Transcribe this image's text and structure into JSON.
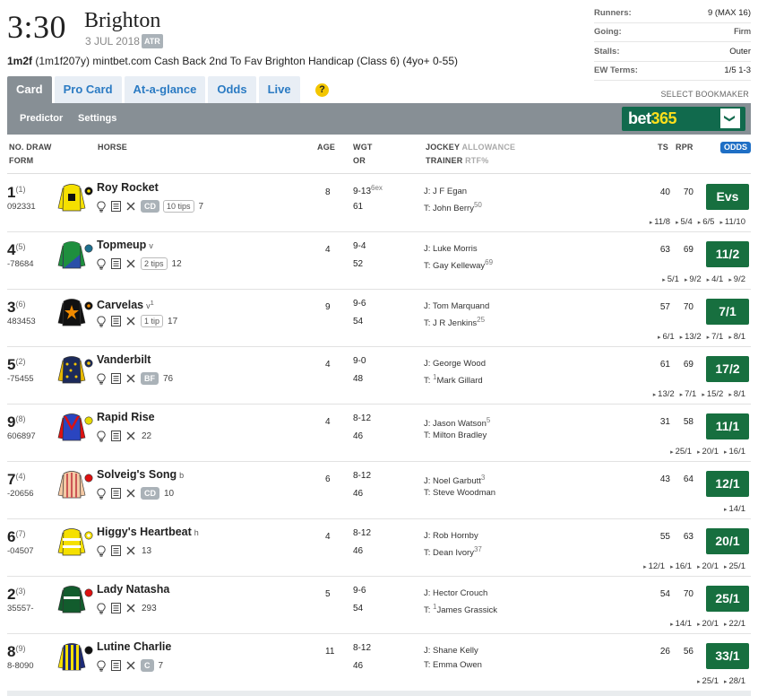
{
  "race": {
    "time": "3:30",
    "course": "Brighton",
    "date": "3 JUL 2018",
    "atr": "ATR",
    "distance": "1m2f",
    "detail": "(1m1f207y) mintbet.com Cash Back 2nd To Fav Brighton Handicap (Class 6) (4yo+ 0-55)"
  },
  "info": [
    {
      "label": "Runners:",
      "value": "9 (MAX 16)"
    },
    {
      "label": "Going:",
      "value": "Firm"
    },
    {
      "label": "Stalls:",
      "value": "Outer"
    },
    {
      "label": "EW Terms:",
      "value": "1/5 1-3"
    }
  ],
  "tabs": [
    "Card",
    "Pro Card",
    "At-a-glance",
    "Odds",
    "Live"
  ],
  "help": "?",
  "select_bookmaker": "SELECT BOOKMAKER",
  "subnav": [
    "Predictor",
    "Settings"
  ],
  "bookmaker": {
    "part1": "bet",
    "part2": "365",
    "chevron": "❯"
  },
  "headers": {
    "no_draw": "NO. DRAW",
    "form": "FORM",
    "horse": "HORSE",
    "age": "AGE",
    "wgt": "WGT",
    "or": "OR",
    "jockey": "JOCKEY",
    "allowance": "ALLOWANCE",
    "trainer": "TRAINER",
    "rtf": "RTF%",
    "ts": "TS",
    "rpr": "RPR",
    "odds": "ODDS"
  },
  "colors": {
    "tab_active": "#878f95",
    "tab_link": "#2b7bc3",
    "odds_green": "#176f3f",
    "bet365_green": "#116a4d",
    "bet365_yellow": "#ffdf1b"
  },
  "runners": [
    {
      "no": "1",
      "draw": "(1)",
      "form": "092331",
      "name": "Roy Rocket",
      "headgear": "",
      "headgear_sup": "",
      "pill": "CD",
      "tips": "10 tips",
      "count": "7",
      "age": "8",
      "wgt": "9-13",
      "wgt_sup": "6ex",
      "or": "61",
      "jockey": "J: J F Egan",
      "jockey_sup": "",
      "trainer_pre": "T: John Berry",
      "trainer_sup": "50",
      "trainer_post": "",
      "ts": "40",
      "rpr": "70",
      "odds": "Evs",
      "movement": [
        "11/8",
        "5/4",
        "6/5",
        "11/10"
      ],
      "silk": "yellow-square"
    },
    {
      "no": "4",
      "draw": "(5)",
      "form": "-78684",
      "name": "Topmeup",
      "headgear": "v",
      "headgear_sup": "",
      "pill": "",
      "tips": "2 tips",
      "count": "12",
      "age": "4",
      "wgt": "9-4",
      "wgt_sup": "",
      "or": "52",
      "jockey": "J: Luke Morris",
      "jockey_sup": "",
      "trainer_pre": "T: Gay Kelleway",
      "trainer_sup": "69",
      "trainer_post": "",
      "ts": "63",
      "rpr": "69",
      "odds": "11/2",
      "movement": [
        "5/1",
        "9/2",
        "4/1",
        "9/2"
      ],
      "silk": "blue-green"
    },
    {
      "no": "3",
      "draw": "(6)",
      "form": "483453",
      "name": "Carvelas",
      "headgear": "v",
      "headgear_sup": "1",
      "pill": "",
      "tips": "1 tip",
      "count": "17",
      "age": "9",
      "wgt": "9-6",
      "wgt_sup": "",
      "or": "54",
      "jockey": "J: Tom Marquand",
      "jockey_sup": "",
      "trainer_pre": "T: J R Jenkins",
      "trainer_sup": "25",
      "trainer_post": "",
      "ts": "57",
      "rpr": "70",
      "odds": "7/1",
      "movement": [
        "6/1",
        "13/2",
        "7/1",
        "8/1"
      ],
      "silk": "black-star"
    },
    {
      "no": "5",
      "draw": "(2)",
      "form": "-75455",
      "name": "Vanderbilt",
      "headgear": "",
      "headgear_sup": "",
      "pill": "BF",
      "tips": "",
      "count": "76",
      "age": "4",
      "wgt": "9-0",
      "wgt_sup": "",
      "or": "48",
      "jockey": "J: George Wood",
      "jockey_sup": "",
      "trainer_pre": "T: ",
      "trainer_sup": "1",
      "trainer_post": "Mark Gillard",
      "ts": "61",
      "rpr": "69",
      "odds": "17/2",
      "movement": [
        "13/2",
        "7/1",
        "15/2",
        "8/1"
      ],
      "silk": "navy-stars"
    },
    {
      "no": "9",
      "draw": "(8)",
      "form": "606897",
      "name": "Rapid Rise",
      "headgear": "",
      "headgear_sup": "",
      "pill": "",
      "tips": "",
      "count": "22",
      "age": "4",
      "wgt": "8-12",
      "wgt_sup": "",
      "or": "46",
      "jockey": "J: Jason Watson",
      "jockey_sup": "5",
      "trainer_pre": "T: Milton Bradley",
      "trainer_sup": "",
      "trainer_post": "",
      "ts": "31",
      "rpr": "58",
      "odds": "11/1",
      "movement": [
        "25/1",
        "20/1",
        "16/1"
      ],
      "silk": "red-blue-v"
    },
    {
      "no": "7",
      "draw": "(4)",
      "form": "-20656",
      "name": "Solveig's Song",
      "headgear": "b",
      "headgear_sup": "",
      "pill": "CD",
      "tips": "",
      "count": "10",
      "age": "6",
      "wgt": "8-12",
      "wgt_sup": "",
      "or": "46",
      "jockey": "J: Noel Garbutt",
      "jockey_sup": "3",
      "trainer_pre": "T: Steve Woodman",
      "trainer_sup": "",
      "trainer_post": "",
      "ts": "43",
      "rpr": "64",
      "odds": "12/1",
      "movement": [
        "14/1"
      ],
      "silk": "peach-stripes"
    },
    {
      "no": "6",
      "draw": "(7)",
      "form": "-04507",
      "name": "Higgy's Heartbeat",
      "headgear": "h",
      "headgear_sup": "",
      "pill": "",
      "tips": "",
      "count": "13",
      "age": "4",
      "wgt": "8-12",
      "wgt_sup": "",
      "or": "46",
      "jockey": "J: Rob Hornby",
      "jockey_sup": "",
      "trainer_pre": "T: Dean Ivory",
      "trainer_sup": "37",
      "trainer_post": "",
      "ts": "55",
      "rpr": "63",
      "odds": "20/1",
      "movement": [
        "12/1",
        "16/1",
        "20/1",
        "25/1"
      ],
      "silk": "yellow-hoops"
    },
    {
      "no": "2",
      "draw": "(3)",
      "form": "35557-",
      "name": "Lady Natasha",
      "headgear": "",
      "headgear_sup": "",
      "pill": "",
      "tips": "",
      "count": "293",
      "age": "5",
      "wgt": "9-6",
      "wgt_sup": "",
      "or": "54",
      "jockey": "J: Hector Crouch",
      "jockey_sup": "",
      "trainer_pre": "T: ",
      "trainer_sup": "1",
      "trainer_post": "James Grassick",
      "ts": "54",
      "rpr": "70",
      "odds": "25/1",
      "movement": [
        "14/1",
        "20/1",
        "22/1"
      ],
      "silk": "green-red"
    },
    {
      "no": "8",
      "draw": "(9)",
      "form": "8-8090",
      "name": "Lutine Charlie",
      "headgear": "",
      "headgear_sup": "",
      "pill": "C",
      "tips": "",
      "count": "7",
      "age": "11",
      "wgt": "8-12",
      "wgt_sup": "",
      "or": "46",
      "jockey": "J: Shane Kelly",
      "jockey_sup": "",
      "trainer_pre": "T: Emma Owen",
      "trainer_sup": "",
      "trainer_post": "",
      "ts": "26",
      "rpr": "56",
      "odds": "33/1",
      "movement": [
        "25/1",
        "28/1"
      ],
      "silk": "yellow-navy-stripes"
    }
  ]
}
